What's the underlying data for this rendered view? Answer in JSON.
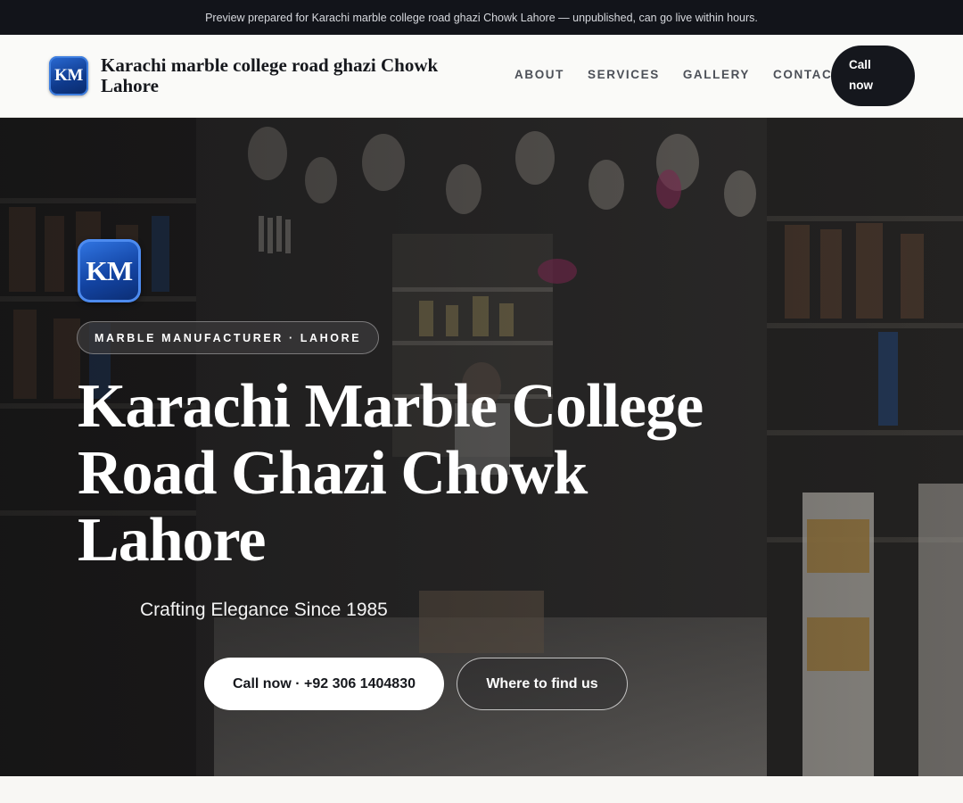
{
  "preview_banner": {
    "text": "Preview prepared for Karachi marble college road ghazi Chowk Lahore — unpublished, can go live within hours."
  },
  "header": {
    "logo_text": "KM",
    "brand_name": "Karachi marble college road ghazi Chowk Lahore",
    "nav_links": [
      "ABOUT",
      "SERVICES",
      "GALLERY",
      "CONTACT"
    ],
    "cta_label": "Call now"
  },
  "hero": {
    "logo_text": "KM",
    "tagline": "MARBLE MANUFACTURER · LAHORE",
    "title": "Karachi Marble College Road Ghazi Chowk Lahore",
    "subtitle": "Crafting Elegance Since 1985",
    "primary_button": "Call now · +92 306 1404830",
    "secondary_button": "Where to find us"
  },
  "colors": {
    "topbar_bg": "#12141a",
    "logo_blue": "#1344a3",
    "cta_dark": "#15171d"
  }
}
